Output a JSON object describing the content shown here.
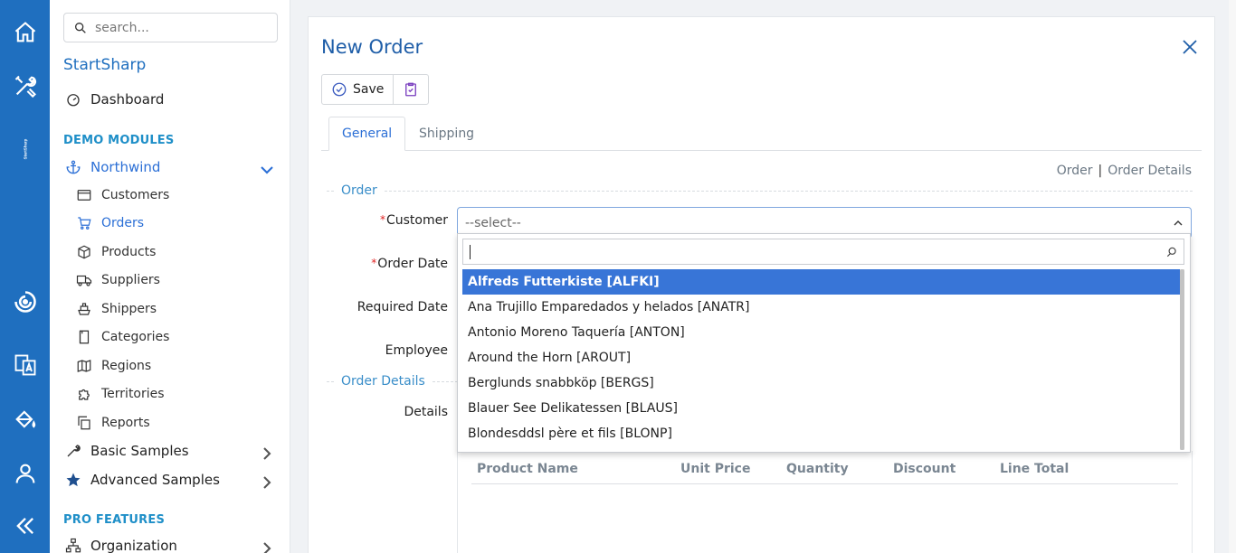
{
  "rail": {
    "brand": "StartSharp",
    "icons": [
      "home-icon",
      "tools-icon",
      "translate-icon",
      "paint-bucket-icon",
      "user-icon",
      "collapse-icon"
    ]
  },
  "sidebar": {
    "search_placeholder": "search...",
    "brand": "StartSharp",
    "dashboard": "Dashboard",
    "section_demo": "DEMO MODULES",
    "northwind": "Northwind",
    "items": [
      {
        "label": "Customers",
        "icon": "card-icon"
      },
      {
        "label": "Orders",
        "icon": "cart-icon"
      },
      {
        "label": "Products",
        "icon": "box-icon"
      },
      {
        "label": "Suppliers",
        "icon": "truck-icon"
      },
      {
        "label": "Shippers",
        "icon": "ship-icon"
      },
      {
        "label": "Categories",
        "icon": "book-icon"
      },
      {
        "label": "Regions",
        "icon": "map-icon"
      },
      {
        "label": "Territories",
        "icon": "puzzle-icon"
      },
      {
        "label": "Reports",
        "icon": "copy-icon"
      }
    ],
    "basic_samples": "Basic Samples",
    "advanced_samples": "Advanced Samples",
    "section_pro": "PRO FEATURES",
    "organization": "Organization"
  },
  "dialog": {
    "title": "New Order",
    "save_label": "Save",
    "tabs": [
      "General",
      "Shipping"
    ],
    "link_order": "Order",
    "link_separator": "|",
    "link_order_details": "Order Details",
    "category_order": "Order",
    "category_order_details": "Order Details",
    "labels": {
      "customer": "Customer",
      "order_date": "Order Date",
      "required_date": "Required Date",
      "employee": "Employee",
      "details": "Details"
    },
    "required_marker": "*",
    "customer_placeholder": "--select--",
    "grid_headers": [
      "Product Name",
      "Unit Price",
      "Quantity",
      "Discount",
      "Line Total"
    ]
  },
  "dropdown": {
    "search_value": "",
    "options": [
      "Alfreds Futterkiste [ALFKI]",
      "Ana Trujillo Emparedados y helados [ANATR]",
      "Antonio Moreno Taquería [ANTON]",
      "Around the Horn [AROUT]",
      "Berglunds snabbköp [BERGS]",
      "Blauer See Delikatessen [BLAUS]",
      "Blondesddsl père et fils [BLONP]"
    ],
    "highlighted_index": 0
  },
  "colors": {
    "rail": "#1f6fbf",
    "accent": "#2b6fd6",
    "highlight": "#3875d7",
    "section": "#1f8fc8"
  }
}
